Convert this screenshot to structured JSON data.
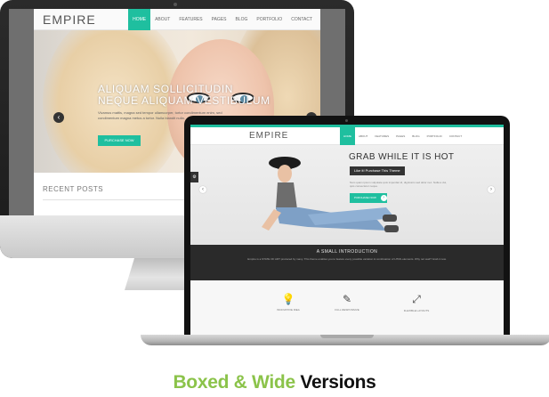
{
  "colors": {
    "accent": "#1fbf9f",
    "caption_green": "#8bc34a",
    "caption_dark": "#111111",
    "dark_band": "#2a2a2a"
  },
  "boxed_site": {
    "logo": "EMPIRE",
    "nav": [
      "HOME",
      "ABOUT",
      "FEATURES",
      "PAGES",
      "BLOG",
      "PORTFOLIO",
      "CONTACT"
    ],
    "active_nav": "HOME",
    "hero_headline": "ALIQUAM SOLLICITUDIN NEQUE ALIQUAM VESTIBULUM",
    "hero_body": "Vivamus mattis, magna sed tempor ullamcorper, tortor condimentum enim, sed condimentum magna metus a tortor. Nulla blandit nulla.",
    "hero_button": "PURCHASE NOW",
    "prev_icon": "chevron-left-icon",
    "next_icon": "chevron-right-icon",
    "recent_posts": "RECENT POSTS"
  },
  "wide_site": {
    "logo": "EMPIRE",
    "nav": [
      "HOME",
      "ABOUT",
      "FEATURES",
      "PAGES",
      "BLOG",
      "PORTFOLIO",
      "CONTACT"
    ],
    "active_nav": "HOME",
    "side_tab_icon": "settings-icon",
    "hero_headline": "GRAB WHILE IT IS HOT",
    "hero_tag": "Like it! Purchase This Theme",
    "hero_body": "Nam quam ipsum vulputate quis imperdiet id, dignissim sed dolor nec. Nulla a dui, quis consectetur neque.",
    "hero_button": "PURCHASE NOW",
    "intro_title": "A SMALL INTRODUCTION",
    "intro_text": "Empire is a STATE OF ART produced by many. This theme enables you to feature every possible variation & combination of HTML elements. Why not wait? Grab it now.",
    "features": [
      {
        "icon": "lightbulb-icon",
        "label": "INNOVATIVE IDEA"
      },
      {
        "icon": "magic-wand-icon",
        "label": "FULL RESPONSIVE"
      },
      {
        "icon": "expand-arrows-icon",
        "label": "FLEXIBLE LAYOUTS"
      }
    ]
  },
  "caption": {
    "part1": "Boxed & Wide",
    "part2": "Versions"
  }
}
